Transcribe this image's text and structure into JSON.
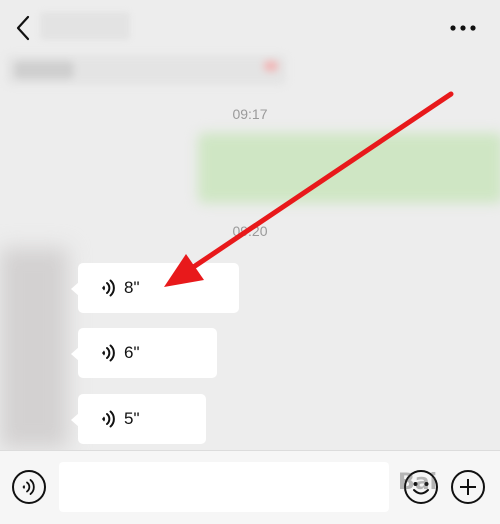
{
  "header": {
    "back_icon": "chevron-left-icon",
    "more_icon": "more-horizontal-icon"
  },
  "messages": {
    "time_1": "09:17",
    "time_2": "09:20",
    "voice": [
      {
        "duration": "8\""
      },
      {
        "duration": "6\""
      },
      {
        "duration": "5\""
      }
    ]
  },
  "input_bar": {
    "voice_icon": "voice-mode-icon",
    "emoji_icon": "emoji-icon",
    "plus_icon": "plus-circle-icon",
    "text_value": ""
  },
  "annotation": {
    "color": "#e8191b"
  },
  "watermark": "Bai"
}
